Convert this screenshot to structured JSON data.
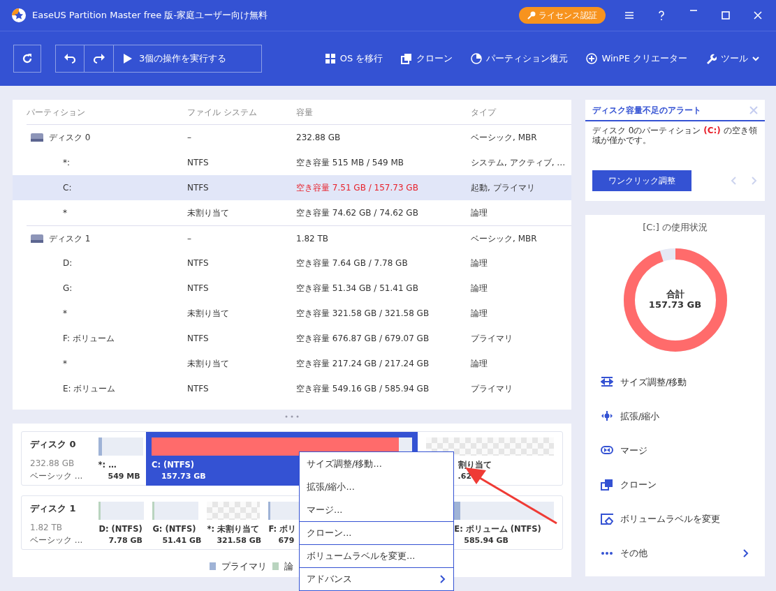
{
  "window": {
    "title": "EaseUS Partition Master free 版-家庭ユーザー向け無料",
    "license_button": "ライセンス認証"
  },
  "toolbar": {
    "run_button": "3個の操作を実行する",
    "actions": [
      {
        "kind": "windows",
        "label": "OS を移行"
      },
      {
        "kind": "clone",
        "label": "クローン"
      },
      {
        "kind": "pie",
        "label": "パーティション復元"
      },
      {
        "kind": "plus",
        "label": "WinPE クリエーター"
      },
      {
        "kind": "wrench",
        "label": "ツール",
        "dropdown": true
      }
    ]
  },
  "table": {
    "columns": [
      "パーティション",
      "ファイル システム",
      "容量",
      "タイプ"
    ],
    "disks": [
      {
        "name": "ディスク 0",
        "file_system": "–",
        "capacity": "232.88 GB",
        "type": "ベーシック, MBR",
        "children": [
          {
            "name": "*:",
            "file_system": "NTFS",
            "capacity": "空き容量 515 MB / 549 MB",
            "type": "システム, アクティブ, …",
            "selected": false,
            "warning": false
          },
          {
            "name": "C:",
            "file_system": "NTFS",
            "capacity": "空き容量 7.51 GB / 157.73 GB",
            "type": "起動, プライマリ",
            "selected": true,
            "warning": true
          },
          {
            "name": "*",
            "file_system": "未割り当て",
            "capacity": "空き容量 74.62 GB / 74.62 GB",
            "type": "論理",
            "selected": false,
            "warning": false
          }
        ]
      },
      {
        "name": "ディスク 1",
        "file_system": "–",
        "capacity": "1.82 TB",
        "type": "ベーシック, MBR",
        "children": [
          {
            "name": "D:",
            "file_system": "NTFS",
            "capacity": "空き容量 7.64 GB / 7.78 GB",
            "type": "論理",
            "selected": false,
            "warning": false
          },
          {
            "name": "G:",
            "file_system": "NTFS",
            "capacity": "空き容量 51.34 GB / 51.41 GB",
            "type": "論理",
            "selected": false,
            "warning": false
          },
          {
            "name": "*",
            "file_system": "未割り当て",
            "capacity": "空き容量 321.58 GB / 321.58 GB",
            "type": "論理",
            "selected": false,
            "warning": false
          },
          {
            "name": "F: ボリューム",
            "file_system": "NTFS",
            "capacity": "空き容量 676.87 GB / 679.07 GB",
            "type": "プライマリ",
            "selected": false,
            "warning": false
          },
          {
            "name": "*",
            "file_system": "未割り当て",
            "capacity": "空き容量 217.24 GB / 217.24 GB",
            "type": "論理",
            "selected": false,
            "warning": false
          },
          {
            "name": "E: ボリューム",
            "file_system": "NTFS",
            "capacity": "空き容量 549.16 GB / 585.94 GB",
            "type": "プライマリ",
            "selected": false,
            "warning": false
          }
        ]
      }
    ]
  },
  "disk_map": {
    "disks": [
      {
        "name": "ディスク 0",
        "size": "232.88 GB",
        "type": "ベーシック ...",
        "partitions": [
          {
            "kind": "primary",
            "label": "*: …",
            "size": "549 MB",
            "level": 0.08,
            "selected": false
          },
          {
            "kind": "primary",
            "label": "C: (NTFS)",
            "size": "157.73 GB",
            "level": 0.95,
            "selected": true,
            "warning": true
          },
          {
            "kind": "unallocated",
            "label": "割り当て",
            "size": ".62",
            "selected": false
          }
        ]
      },
      {
        "name": "ディスク 1",
        "size": "1.82 TB",
        "type": "ベーシック ...",
        "partitions": [
          {
            "kind": "logical",
            "label": "D: (NTFS)",
            "size": "7.78 GB",
            "level": 0.02,
            "selected": false
          },
          {
            "kind": "logical",
            "label": "G: (NTFS)",
            "size": "51.41 GB",
            "level": 0.01,
            "selected": false
          },
          {
            "kind": "unallocated",
            "label": "*: 未割り当て",
            "size": "321.58 GB",
            "selected": false
          },
          {
            "kind": "primary",
            "label": "F: ボリ",
            "size": "679",
            "level": 0.01,
            "selected": false
          },
          {
            "kind": "primary",
            "label": "E: ボリューム (NTFS)",
            "size": "585.94 GB",
            "level": 0.06,
            "selected": false
          }
        ]
      }
    ],
    "legend": [
      {
        "label": "プライマリ",
        "color": "#9fb3d6"
      },
      {
        "label": "論",
        "color": "#b9d4bf"
      }
    ]
  },
  "context_menu": [
    {
      "label": "サイズ調整/移動...",
      "separator": false,
      "submenu": false
    },
    {
      "label": "拡張/縮小...",
      "separator": false,
      "submenu": false
    },
    {
      "label": "マージ...",
      "separator": false,
      "submenu": false
    },
    {
      "label": "クローン...",
      "separator": true,
      "submenu": false
    },
    {
      "label": "ボリュームラベルを変更...",
      "separator": true,
      "submenu": false
    },
    {
      "label": "アドバンス",
      "separator": true,
      "submenu": true
    }
  ],
  "alert": {
    "title": "ディスク容量不足のアラート",
    "message": "ディスク 0のパーティション **(C:)** の空き領域が僅かです。",
    "button": "ワンクリック調整"
  },
  "usage": {
    "title": "[C:] の使用状況",
    "total_label": "合計",
    "total": "157.73 GB",
    "level": 0.95
  },
  "actions": [
    {
      "kind": "resize",
      "label": "サイズ調整/移動"
    },
    {
      "kind": "extend",
      "label": "拡張/縮小"
    },
    {
      "kind": "merge",
      "label": "マージ"
    },
    {
      "kind": "clone",
      "label": "クローン"
    },
    {
      "kind": "label",
      "label": "ボリュームラベルを変更"
    },
    {
      "kind": "more",
      "label": "その他",
      "submenu": true
    }
  ]
}
